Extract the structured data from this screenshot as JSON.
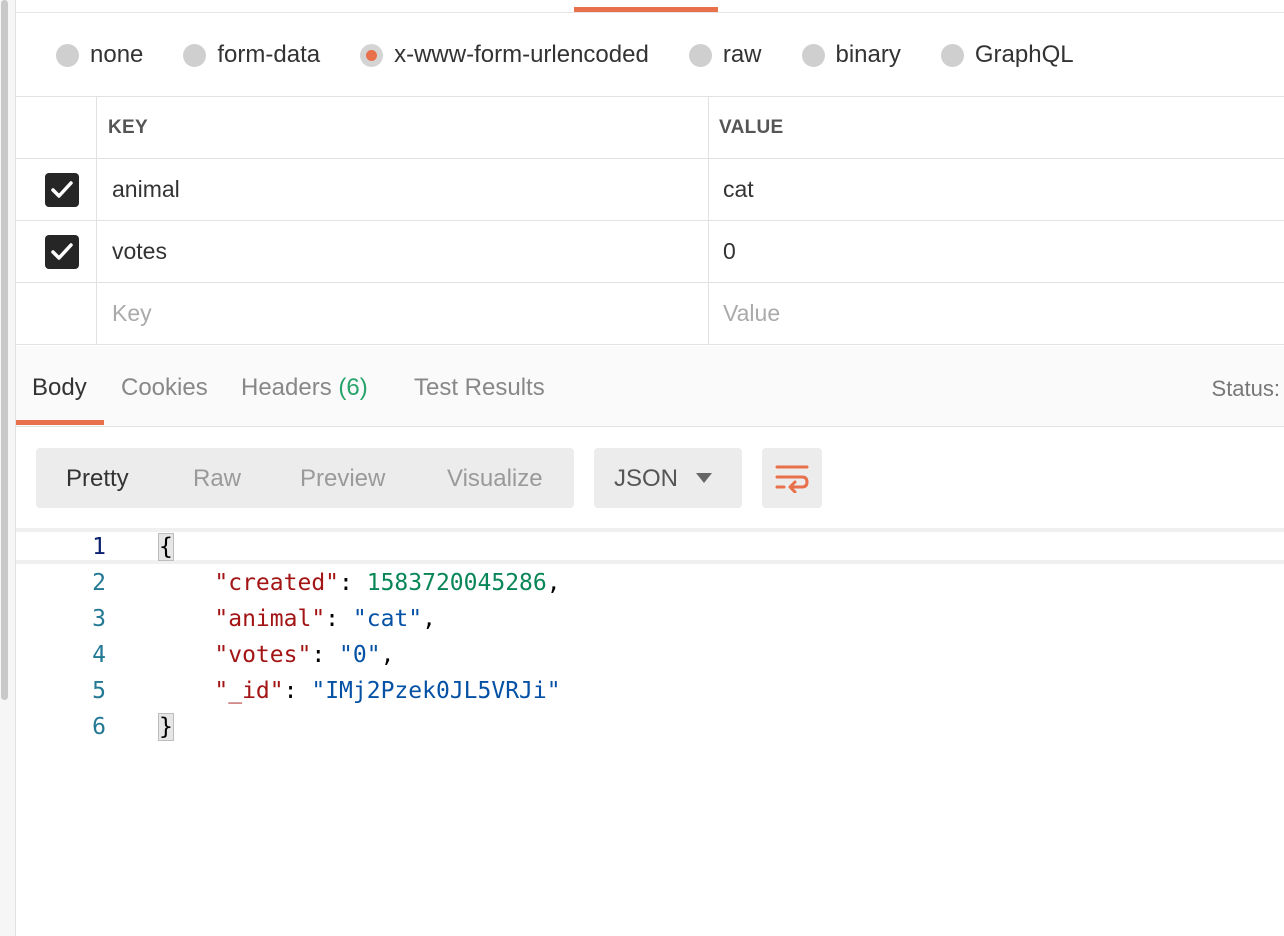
{
  "body_types": [
    {
      "label": "none",
      "selected": false
    },
    {
      "label": "form-data",
      "selected": false
    },
    {
      "label": "x-www-form-urlencoded",
      "selected": true
    },
    {
      "label": "raw",
      "selected": false
    },
    {
      "label": "binary",
      "selected": false
    },
    {
      "label": "GraphQL",
      "selected": false
    }
  ],
  "params_table": {
    "headers": {
      "key": "KEY",
      "value": "VALUE"
    },
    "rows": [
      {
        "checked": true,
        "key": "animal",
        "value": "cat"
      },
      {
        "checked": true,
        "key": "votes",
        "value": "0"
      }
    ],
    "new_row": {
      "key_placeholder": "Key",
      "value_placeholder": "Value"
    }
  },
  "response_tabs": {
    "body": "Body",
    "cookies": "Cookies",
    "headers": "Headers",
    "headers_count": "(6)",
    "test_results": "Test Results",
    "active": "Body",
    "status_label": "Status:"
  },
  "view_modes": {
    "pretty": "Pretty",
    "raw": "Raw",
    "preview": "Preview",
    "visualize": "Visualize",
    "active": "Pretty"
  },
  "format": {
    "selected": "JSON"
  },
  "response_code": {
    "line_numbers": [
      "1",
      "2",
      "3",
      "4",
      "5",
      "6"
    ],
    "open_brace": "{",
    "close_brace": "}",
    "fields": [
      {
        "key": "\"created\"",
        "value": "1583720045286",
        "type": "number"
      },
      {
        "key": "\"animal\"",
        "value": "\"cat\"",
        "type": "string"
      },
      {
        "key": "\"votes\"",
        "value": "\"0\"",
        "type": "string"
      },
      {
        "key": "\"_id\"",
        "value": "\"IMj2Pzek0JL5VRJi\"",
        "type": "string"
      }
    ]
  },
  "colors": {
    "accent": "#e8704a",
    "count_green": "#27a46b",
    "json_key": "#a31515",
    "json_number": "#098658",
    "json_string": "#0451a5",
    "line_number": "#237893"
  }
}
